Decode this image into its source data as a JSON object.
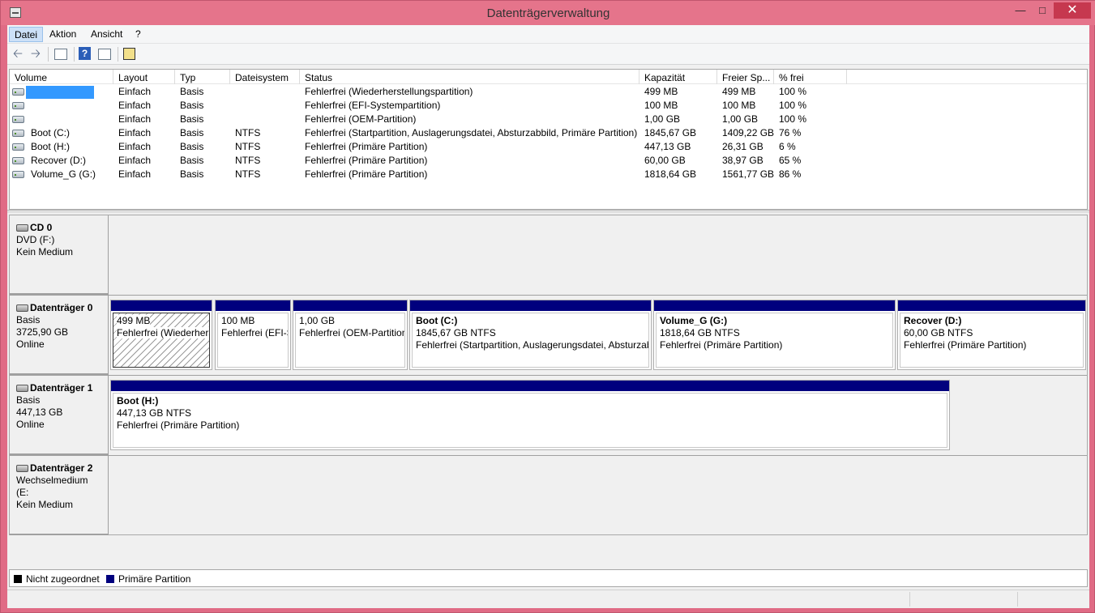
{
  "window": {
    "title": "Datenträgerverwaltung"
  },
  "menu": [
    "Datei",
    "Aktion",
    "Ansicht",
    "?"
  ],
  "toolbar": [
    "back-arrow-icon",
    "forward-arrow-icon",
    "properties-icon",
    "help-icon",
    "show-hide-pane-icon",
    "settings-icon"
  ],
  "volume_table": {
    "columns": [
      "Volume",
      "Layout",
      "Typ",
      "Dateisystem",
      "Status",
      "Kapazität",
      "Freier Sp...",
      "% frei"
    ],
    "rows": [
      [
        "",
        "Einfach",
        "Basis",
        "",
        "Fehlerfrei (Wiederherstellungspartition)",
        "499 MB",
        "499 MB",
        "100 %"
      ],
      [
        "",
        "Einfach",
        "Basis",
        "",
        "Fehlerfrei (EFI-Systempartition)",
        "100 MB",
        "100 MB",
        "100 %"
      ],
      [
        "",
        "Einfach",
        "Basis",
        "",
        "Fehlerfrei (OEM-Partition)",
        "1,00 GB",
        "1,00 GB",
        "100 %"
      ],
      [
        "Boot (C:)",
        "Einfach",
        "Basis",
        "NTFS",
        "Fehlerfrei (Startpartition, Auslagerungsdatei, Absturzabbild, Primäre Partition)",
        "1845,67 GB",
        "1409,22 GB",
        "76 %"
      ],
      [
        "Boot (H:)",
        "Einfach",
        "Basis",
        "NTFS",
        "Fehlerfrei (Primäre Partition)",
        "447,13 GB",
        "26,31 GB",
        "6 %"
      ],
      [
        "Recover (D:)",
        "Einfach",
        "Basis",
        "NTFS",
        "Fehlerfrei (Primäre Partition)",
        "60,00 GB",
        "38,97 GB",
        "65 %"
      ],
      [
        "Volume_G (G:)",
        "Einfach",
        "Basis",
        "NTFS",
        "Fehlerfrei (Primäre Partition)",
        "1818,64 GB",
        "1561,77 GB",
        "86 %"
      ]
    ]
  },
  "disks": {
    "cd0": {
      "name": "CD 0",
      "line1": "DVD (F:)",
      "line2": "",
      "line3": "Kein Medium"
    },
    "d0": {
      "name": "Datenträger 0",
      "line1": "Basis",
      "line2": "3725,90 GB",
      "line3": "Online",
      "parts": [
        {
          "title": "",
          "size": "499 MB",
          "status": "Fehlerfrei (Wiederhers"
        },
        {
          "title": "",
          "size": "100 MB",
          "status": "Fehlerfrei (EFI-S"
        },
        {
          "title": "",
          "size": "1,00 GB",
          "status": "Fehlerfrei (OEM-Partition"
        },
        {
          "title": "Boot  (C:)",
          "size": "1845,67 GB NTFS",
          "status": "Fehlerfrei (Startpartition, Auslagerungsdatei, Absturzab"
        },
        {
          "title": "Volume_G  (G:)",
          "size": "1818,64 GB NTFS",
          "status": "Fehlerfrei (Primäre Partition)"
        },
        {
          "title": "Recover  (D:)",
          "size": "60,00 GB NTFS",
          "status": "Fehlerfrei (Primäre Partition)"
        }
      ]
    },
    "d1": {
      "name": "Datenträger 1",
      "line1": "Basis",
      "line2": "447,13 GB",
      "line3": "Online",
      "parts": [
        {
          "title": "Boot  (H:)",
          "size": "447,13 GB NTFS",
          "status": "Fehlerfrei (Primäre Partition)"
        }
      ]
    },
    "d2": {
      "name": "Datenträger 2",
      "line1": "Wechselmedium (E:",
      "line2": "",
      "line3": "Kein Medium"
    }
  },
  "legend": [
    {
      "label": "Nicht zugeordnet",
      "color": "#000000"
    },
    {
      "label": "Primäre Partition",
      "color": "#00007e"
    }
  ]
}
